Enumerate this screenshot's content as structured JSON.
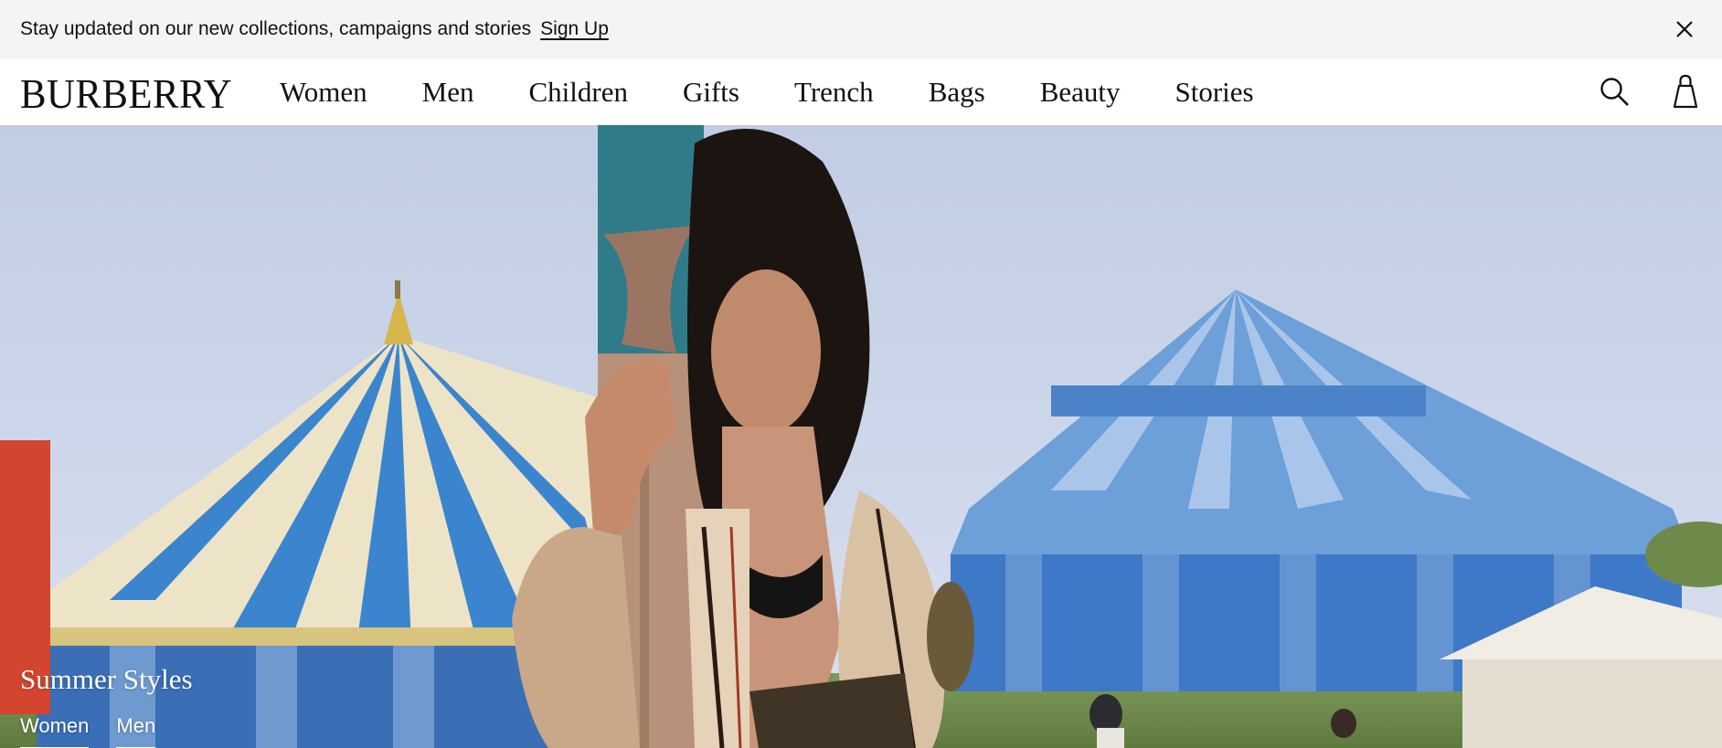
{
  "announcement": {
    "text": "Stay updated on our new collections, campaigns and stories",
    "link": "Sign Up",
    "close_icon": "close-icon"
  },
  "header": {
    "logo": "BURBERRY",
    "nav": [
      "Women",
      "Men",
      "Children",
      "Gifts",
      "Trench",
      "Bags",
      "Beauty",
      "Stories"
    ],
    "icons": {
      "search": "search-icon",
      "bag": "shopping-bag-icon"
    }
  },
  "hero": {
    "title": "Summer Styles",
    "links": [
      "Women",
      "Men"
    ]
  }
}
